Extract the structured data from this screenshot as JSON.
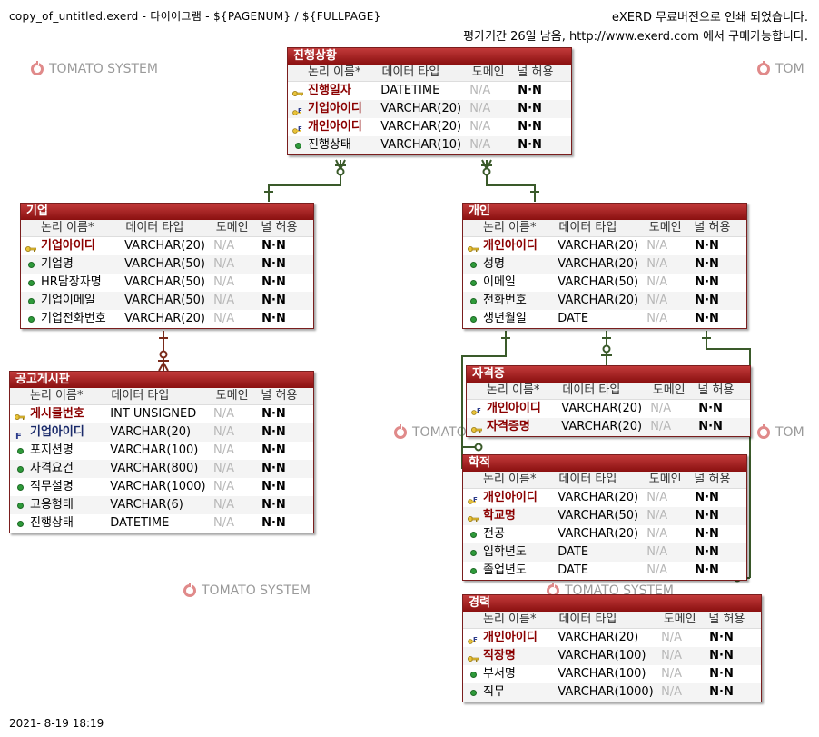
{
  "header": {
    "file": "copy_of_untitled.exerd  - 다이어그램 - ${PAGENUM} / ${FULLPAGE}",
    "notice1": "eXERD 무료버전으로 인쇄 되었습니다.",
    "notice2": "평가기간 26일 남음, http://www.exerd.com 에서 구매가능합니다."
  },
  "footer": {
    "timestamp": "2021- 8-19 18:19"
  },
  "watermark": {
    "full": "TOMATO SYSTEM",
    "cut": "TOM",
    "cut2": "TOMATO"
  },
  "columns": {
    "name": "논리 이름*",
    "type": "데이터 타입",
    "domain": "도메인",
    "null": "널 허용"
  },
  "colors": {
    "title": "#a01c1c",
    "relationship": "#3a5a2a",
    "relationship_alt": "#7a2a1a"
  },
  "entities": {
    "progress": {
      "title": "진행상황",
      "rows": [
        {
          "name": "진행일자",
          "type": "DATETIME",
          "domain": "N/A",
          "null": "N·N",
          "key": "pk"
        },
        {
          "name": "기업아이디",
          "type": "VARCHAR(20)",
          "domain": "N/A",
          "null": "N·N",
          "key": "pkfk"
        },
        {
          "name": "개인아이디",
          "type": "VARCHAR(20)",
          "domain": "N/A",
          "null": "N·N",
          "key": "pkfk"
        },
        {
          "name": "진행상태",
          "type": "VARCHAR(10)",
          "domain": "N/A",
          "null": "N·N",
          "key": "none"
        }
      ]
    },
    "company": {
      "title": "기업",
      "rows": [
        {
          "name": "기업아이디",
          "type": "VARCHAR(20)",
          "domain": "N/A",
          "null": "N·N",
          "key": "pk"
        },
        {
          "name": "기업명",
          "type": "VARCHAR(50)",
          "domain": "N/A",
          "null": "N·N",
          "key": "none"
        },
        {
          "name": "HR담장자명",
          "type": "VARCHAR(50)",
          "domain": "N/A",
          "null": "N·N",
          "key": "none"
        },
        {
          "name": "기업이메일",
          "type": "VARCHAR(50)",
          "domain": "N/A",
          "null": "N·N",
          "key": "none"
        },
        {
          "name": "기업전화번호",
          "type": "VARCHAR(20)",
          "domain": "N/A",
          "null": "N·N",
          "key": "none"
        }
      ]
    },
    "person": {
      "title": "개인",
      "rows": [
        {
          "name": "개인아이디",
          "type": "VARCHAR(20)",
          "domain": "N/A",
          "null": "N·N",
          "key": "pk"
        },
        {
          "name": "성명",
          "type": "VARCHAR(20)",
          "domain": "N/A",
          "null": "N·N",
          "key": "none"
        },
        {
          "name": "이메일",
          "type": "VARCHAR(50)",
          "domain": "N/A",
          "null": "N·N",
          "key": "none"
        },
        {
          "name": "전화번호",
          "type": "VARCHAR(20)",
          "domain": "N/A",
          "null": "N·N",
          "key": "none"
        },
        {
          "name": "생년월일",
          "type": "DATE",
          "domain": "N/A",
          "null": "N·N",
          "key": "none"
        }
      ]
    },
    "board": {
      "title": "공고게시판",
      "rows": [
        {
          "name": "게시물번호",
          "type": "INT UNSIGNED",
          "domain": "N/A",
          "null": "N·N",
          "key": "pk"
        },
        {
          "name": "기업아이디",
          "type": "VARCHAR(20)",
          "domain": "N/A",
          "null": "N·N",
          "key": "fk"
        },
        {
          "name": "포지션명",
          "type": "VARCHAR(100)",
          "domain": "N/A",
          "null": "N·N",
          "key": "none"
        },
        {
          "name": "자격요건",
          "type": "VARCHAR(800)",
          "domain": "N/A",
          "null": "N·N",
          "key": "none"
        },
        {
          "name": "직무설명",
          "type": "VARCHAR(1000)",
          "domain": "N/A",
          "null": "N·N",
          "key": "none"
        },
        {
          "name": "고용형태",
          "type": "VARCHAR(6)",
          "domain": "N/A",
          "null": "N·N",
          "key": "none"
        },
        {
          "name": "진행상태",
          "type": "DATETIME",
          "domain": "N/A",
          "null": "N·N",
          "key": "none"
        }
      ]
    },
    "cert": {
      "title": "자격증",
      "rows": [
        {
          "name": "개인아이디",
          "type": "VARCHAR(20)",
          "domain": "N/A",
          "null": "N·N",
          "key": "pkfk"
        },
        {
          "name": "자격증명",
          "type": "VARCHAR(20)",
          "domain": "N/A",
          "null": "N·N",
          "key": "pk"
        }
      ]
    },
    "education": {
      "title": "학적",
      "rows": [
        {
          "name": "개인아이디",
          "type": "VARCHAR(20)",
          "domain": "N/A",
          "null": "N·N",
          "key": "pkfk"
        },
        {
          "name": "학교명",
          "type": "VARCHAR(50)",
          "domain": "N/A",
          "null": "N·N",
          "key": "pk"
        },
        {
          "name": "전공",
          "type": "VARCHAR(20)",
          "domain": "N/A",
          "null": "N·N",
          "key": "none"
        },
        {
          "name": "입학년도",
          "type": "DATE",
          "domain": "N/A",
          "null": "N·N",
          "key": "none"
        },
        {
          "name": "졸업년도",
          "type": "DATE",
          "domain": "N/A",
          "null": "N·N",
          "key": "none"
        }
      ]
    },
    "career": {
      "title": "경력",
      "rows": [
        {
          "name": "개인아이디",
          "type": "VARCHAR(20)",
          "domain": "N/A",
          "null": "N·N",
          "key": "pkfk"
        },
        {
          "name": "직장명",
          "type": "VARCHAR(100)",
          "domain": "N/A",
          "null": "N·N",
          "key": "pk"
        },
        {
          "name": "부서명",
          "type": "VARCHAR(100)",
          "domain": "N/A",
          "null": "N·N",
          "key": "none"
        },
        {
          "name": "직무",
          "type": "VARCHAR(1000)",
          "domain": "N/A",
          "null": "N·N",
          "key": "none"
        }
      ]
    }
  }
}
